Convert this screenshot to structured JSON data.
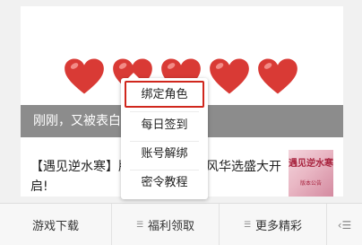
{
  "article": {
    "overlay_text": "刚刚，又被表白了",
    "title": "【遇见逆水寒】版本更新公告，风华选盛大开启!",
    "hearts_count": 5,
    "heart_color": "#d93a35",
    "thumbnail": {
      "title_line": "遇见逆水寒",
      "subtitle_line": "版本公告"
    }
  },
  "popup_menu": {
    "items": [
      "绑定角色",
      "每日签到",
      "账号解绑",
      "密令教程"
    ],
    "highlight_color": "#d0271d"
  },
  "tabbar": {
    "tabs": [
      "游戏下载",
      "福利领取",
      "更多精彩"
    ],
    "keyboard_icon": "keyboard-icon",
    "menu_icon": "menu-icon"
  }
}
